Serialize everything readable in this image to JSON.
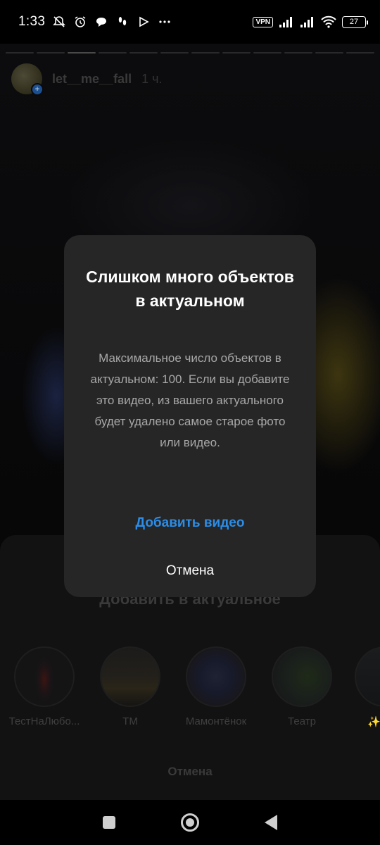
{
  "status_bar": {
    "time": "1:33",
    "vpn": "VPN",
    "battery": "27"
  },
  "story": {
    "username": "let__me__fall",
    "posted_ago": "1 ч."
  },
  "highlights_sheet": {
    "title": "Добавить в актуальное",
    "items": [
      {
        "label": "ТестНаЛюбо..."
      },
      {
        "label": "ТМ"
      },
      {
        "label": "Мамонтёнок"
      },
      {
        "label": "Театр"
      },
      {
        "label": "✨"
      }
    ],
    "cancel_label": "Отмена"
  },
  "dialog": {
    "title": "Слишком много объектов в актуальном",
    "body": "Максимальное число объектов в актуальном: 100. Если вы добавите это видео, из вашего актуального будет удалено самое старое фото или видео.",
    "primary_label": "Добавить видео",
    "cancel_label": "Отмена",
    "primary_color": "#2b8de8"
  },
  "navigation": {
    "recents": "square-icon",
    "home": "circle-icon",
    "back": "triangle-back-icon"
  }
}
